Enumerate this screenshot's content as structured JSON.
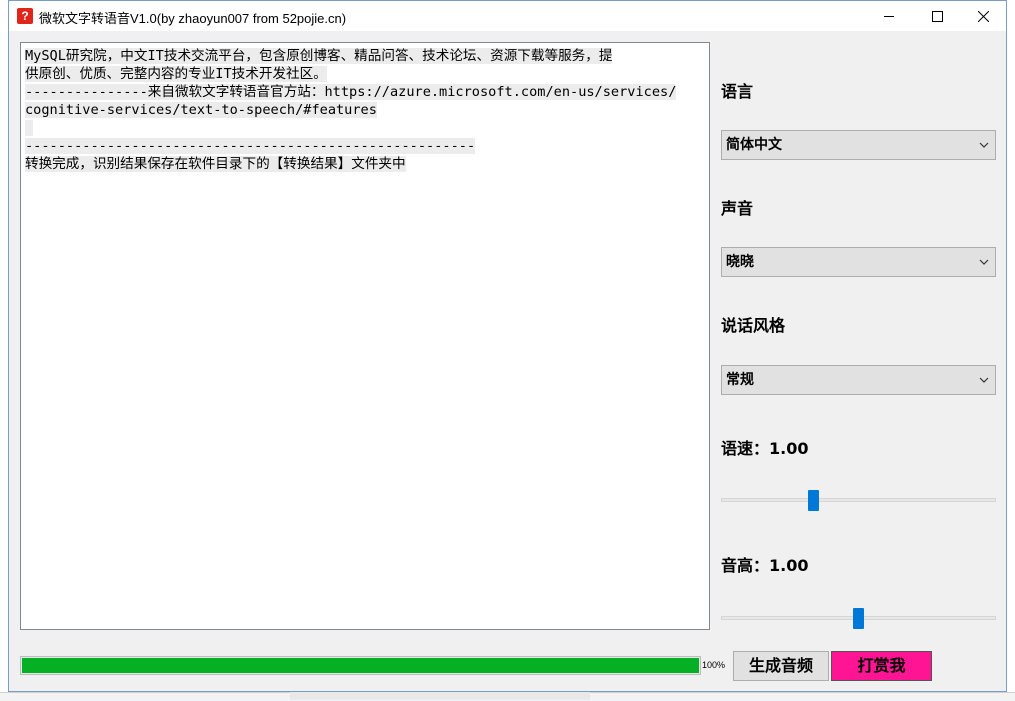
{
  "window": {
    "title": "微软文字转语音V1.0(by zhaoyun007 from 52pojie.cn)",
    "icon_glyph": "?"
  },
  "output": {
    "lines": [
      "MySQL研究院，中文IT技术交流平台，包含原创博客、精品问答、技术论坛、资源下载等服务，提",
      "供原创、优质、完整内容的专业IT技术开发社区。",
      "---------------来自微软文字转语音官方站：https://azure.microsoft.com/en-us/services/",
      "cognitive-services/text-to-speech/#features",
      " ",
      "-------------------------------------------------------",
      "转换完成，识别结果保存在软件目录下的【转换结果】文件夹中"
    ]
  },
  "settings": {
    "language_label": "语言",
    "language_value": "简体中文",
    "voice_label": "声音",
    "voice_value": "晓晓",
    "style_label": "说话风格",
    "style_value": "常规",
    "rate_label": "语速：1.00",
    "rate_value": 1.0,
    "pitch_label": "音高：1.00",
    "pitch_value": 1.0
  },
  "footer": {
    "progress_percent": 100,
    "progress_text": "100%",
    "generate_label": "生成音频",
    "reward_label": "打赏我"
  },
  "colors": {
    "progress_green": "#06b025",
    "reward_pink": "#ff1493",
    "slider_blue": "#0078d7"
  },
  "icons": [
    "app-icon",
    "minimize-icon",
    "maximize-icon",
    "close-icon",
    "chevron-down-icon"
  ]
}
